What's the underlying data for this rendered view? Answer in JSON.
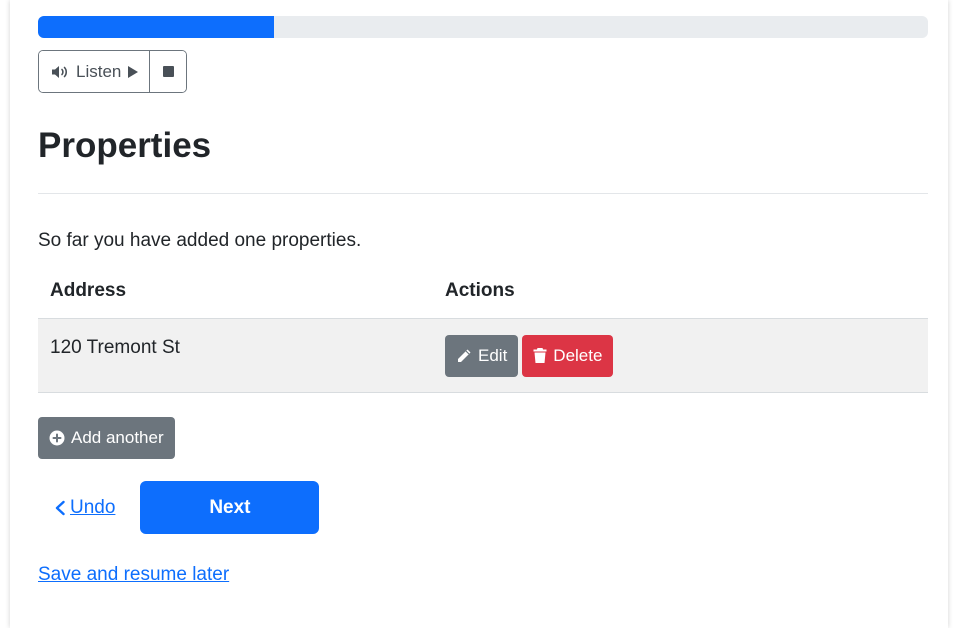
{
  "progress": {
    "fraction": 0.265,
    "color": "#0d6efd"
  },
  "listen": {
    "label": "Listen",
    "speaker_icon": "speaker-icon",
    "play_icon": "play-icon",
    "stop_icon": "stop-icon"
  },
  "page": {
    "title": "Properties",
    "summary": "So far you have added one properties."
  },
  "table": {
    "headers": {
      "address": "Address",
      "actions": "Actions"
    },
    "rows": [
      {
        "address": "120 Tremont St",
        "edit_label": "Edit",
        "delete_label": "Delete"
      }
    ]
  },
  "buttons": {
    "add_another": "Add another",
    "undo": "Undo",
    "next": "Next",
    "save_resume": "Save and resume later"
  },
  "colors": {
    "primary": "#0d6efd",
    "secondary": "#6c757d",
    "danger": "#dc3545"
  }
}
